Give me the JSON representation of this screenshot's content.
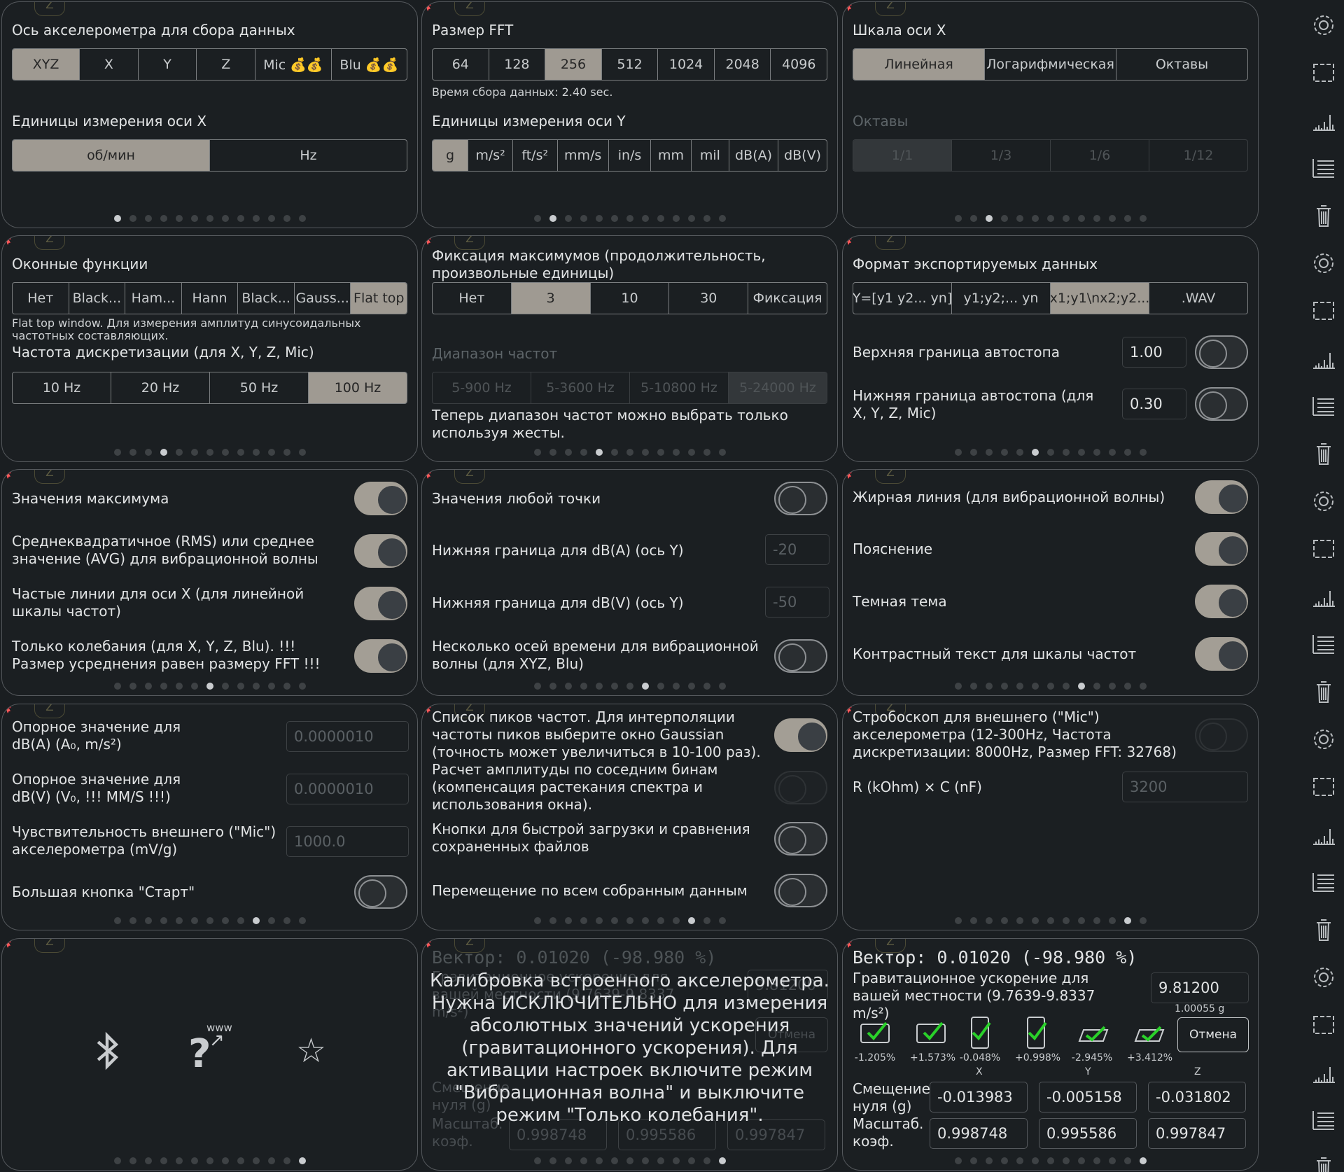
{
  "accel_axis": {
    "title": "Ось акселерометра для сбора данных",
    "options": [
      "XYZ",
      "X",
      "Y",
      "Z",
      "Mic 💰💰",
      "Blu 💰💰"
    ],
    "selected": "XYZ",
    "x_units_title": "Единицы измерения оси X",
    "x_units": [
      "об/мин",
      "Hz"
    ],
    "x_units_selected": "об/мин"
  },
  "fft": {
    "title": "Размер FFT",
    "options": [
      "64",
      "128",
      "256",
      "512",
      "1024",
      "2048",
      "4096"
    ],
    "selected": "256",
    "collect_time": "Время сбора данных: 2.40 sec.",
    "y_units_title": "Единицы измерения оси Y",
    "y_units": [
      "g",
      "m/s²",
      "ft/s²",
      "mm/s",
      "in/s",
      "mm",
      "mil",
      "dB(A)",
      "dB(V)"
    ],
    "y_units_selected": "g"
  },
  "x_scale": {
    "title": "Шкала оси X",
    "options": [
      "Линейная",
      "Логарифмическая",
      "Октавы"
    ],
    "selected": "Линейная",
    "octaves_title": "Октавы",
    "octaves": [
      "1/1",
      "1/3",
      "1/6",
      "1/12"
    ],
    "octaves_selected": "1/1"
  },
  "window": {
    "title": "Оконные функции",
    "options": [
      "Нет",
      "Black...",
      "Ham...",
      "Hann",
      "Black...",
      "Gauss...",
      "Flat top"
    ],
    "selected": "Flat top",
    "note": "Flat top window. Для измерения амплитуд синусоидальных частотных составляющих.",
    "rate_title": "Частота дискретизации (для X, Y, Z, Mic)",
    "rates": [
      "10 Hz",
      "20 Hz",
      "50 Hz",
      "100 Hz"
    ],
    "rate_selected": "100 Hz"
  },
  "peakhold": {
    "title": "Фиксация максимумов (продолжительность, произвольные единицы)",
    "options": [
      "Нет",
      "3",
      "10",
      "30",
      "Фиксация"
    ],
    "selected": "3",
    "range_title": "Диапазон частот",
    "ranges": [
      "5-900 Hz",
      "5-3600 Hz",
      "5-10800 Hz",
      "5-24000 Hz"
    ],
    "range_selected": "5-24000 Hz",
    "range_note": "Теперь диапазон частот можно выбрать только используя жесты."
  },
  "export": {
    "title": "Формат экспортируемых данных",
    "options": [
      "Y=[y1 y2... yn]",
      "y1;y2;... yn",
      "x1;y1\\nx2;y2...",
      ".WAV"
    ],
    "selected": "x1;y1\\nx2;y2...",
    "upper_label": "Верхняя граница автостопа",
    "upper_value": "1.00",
    "lower_label": "Нижняя граница автостопа (для X, Y, Z, Mic)",
    "lower_value": "0.30"
  },
  "toggles1": {
    "items": [
      {
        "label": "Значения максимума",
        "on": true
      },
      {
        "label": "Среднеквадратичное (RMS) или среднее значение (AVG) для вибрационной волны",
        "on": true
      },
      {
        "label": "Частые линии для оси X (для линейной шкалы частот)",
        "on": true
      },
      {
        "label": "Только колебания (для X, Y, Z, Blu). !!! Размер усреднения равен размеру FFT !!!",
        "on": true
      }
    ]
  },
  "toggles2": {
    "any_point": "Значения любой точки",
    "dba_label": "Нижняя граница для dB(A) (ось Y)",
    "dba_value": "-20",
    "dbv_label": "Нижняя граница для dB(V) (ось Y)",
    "dbv_value": "-50",
    "multi_label": "Несколько осей времени для вибрационной волны (для XYZ, Blu)"
  },
  "toggles3": {
    "items": [
      {
        "label": "Жирная линия (для вибрационной волны)",
        "on": true
      },
      {
        "label": "Пояснение",
        "on": true
      },
      {
        "label": "Темная тема",
        "on": true
      },
      {
        "label": "Контрастный текст для шкалы частот",
        "on": true
      }
    ]
  },
  "refs": {
    "dba_label": "Опорное значение для dB(A) (A₀, m/s²)",
    "dba_value": "0.0000010",
    "dbv_label": "Опорное значение для dB(V) (V₀, !!! MM/S !!!)",
    "dbv_value": "0.0000010",
    "sens_label": "Чувствительность внешнего (\"Mic\") акселерометра (mV/g)",
    "sens_value": "1000.0",
    "start_label": "Большая кнопка \"Старт\""
  },
  "peaks": {
    "list_label": "Список пиков частот. Для интерполяции частоты пиков выберите окно Gaussian (точность может увеличиться в 10-100 раз).",
    "amp_label": "Расчет амплитуды по соседним бинам (компенсация растекания спектра и использования окна).",
    "quick_label": "Кнопки для быстрой загрузки и сравнения сохраненных файлов",
    "move_label": "Перемещение по всем собранным данным"
  },
  "strobe": {
    "label": "Стробоскоп для внешнего (\"Mic\") акселерометра (12-300Hz, Частота дискретизации: 8000Hz, Размер FFT: 32768)",
    "rc_label": "R (kOhm) × C (nF)",
    "rc_value": "3200"
  },
  "calib": {
    "vector": "Вектор: 0.01020 (-98.980 %)",
    "gravity_label": "Гравитационное ускорение для вашей местности (9.7639-9.8337 m/s²)",
    "gravity_value": "9.81200",
    "gravity_g": "1.00055 g",
    "pcts": [
      "-1.205%",
      "+1.573%",
      "-0.048%",
      "+0.998%",
      "-2.945%",
      "+3.412%"
    ],
    "cancel": "Отмена",
    "axes": [
      "X",
      "Y",
      "Z"
    ],
    "offset_label": "Смещение нуля (g)",
    "offsets": [
      "-0.013983",
      "-0.005158",
      "-0.031802"
    ],
    "scale_label": "Масштаб. коэф.",
    "scales": [
      "0.998748",
      "0.995586",
      "0.997847"
    ],
    "overlay": "Калибровка встроенного акселерометра. Нужна ИСКЛЮЧИТЕЛЬНО для измерения абсолютных значений ускорения (гравитационного ускорения). Для активации настроек включите режим \"Вибрационная волна\" и выключите режим \"Только колебания\"."
  },
  "about": {
    "icons": [
      "bluetooth-icon",
      "help-web-icon",
      "star-icon"
    ],
    "www": "www"
  },
  "colors": {
    "background": "#1a1e21",
    "selected": "#9f9a92",
    "border": "#55595d",
    "check": "#2ad12a"
  }
}
